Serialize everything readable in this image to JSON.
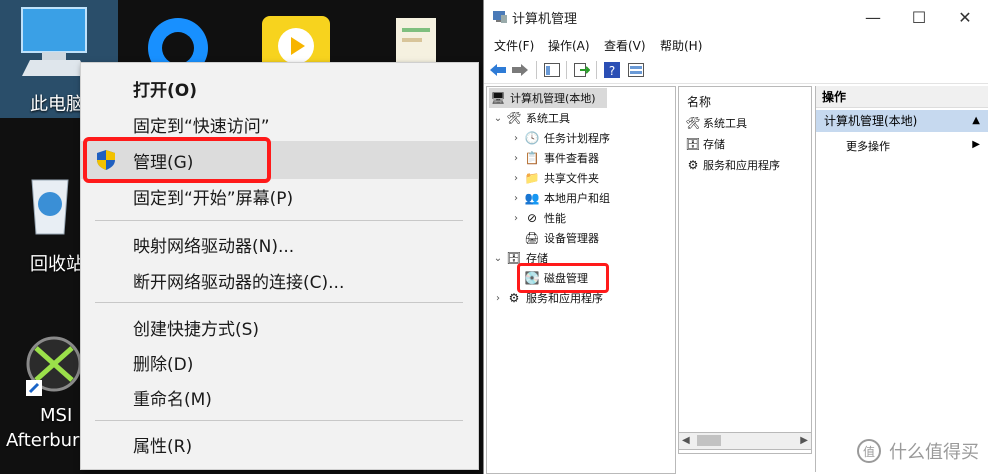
{
  "desktop": {
    "icons": [
      {
        "label": "此电脑",
        "icon": "this-pc-icon"
      },
      {
        "label": "回收站",
        "icon": "recycle-bin-icon"
      },
      {
        "label": "MSI",
        "label2": "Afterburner",
        "icon": "msi-afterburner-icon"
      }
    ],
    "context_menu": {
      "items": [
        {
          "label": "打开(O)"
        },
        {
          "label": "固定到“快速访问”"
        },
        {
          "label": "管理(G)"
        },
        {
          "label": "固定到“开始”屏幕(P)"
        },
        {
          "label": "映射网络驱动器(N)..."
        },
        {
          "label": "断开网络驱动器的连接(C)..."
        },
        {
          "label": "创建快捷方式(S)"
        },
        {
          "label": "删除(D)"
        },
        {
          "label": "重命名(M)"
        },
        {
          "label": "属性(R)"
        }
      ]
    }
  },
  "window": {
    "title": "计算机管理",
    "controls": {
      "minimize": "—",
      "maximize": "☐",
      "close": "✕"
    },
    "menu": [
      "文件(F)",
      "操作(A)",
      "查看(V)",
      "帮助(H)"
    ],
    "tree": [
      {
        "label": "计算机管理(本地)"
      },
      {
        "label": "系统工具"
      },
      {
        "label": "任务计划程序"
      },
      {
        "label": "事件查看器"
      },
      {
        "label": "共享文件夹"
      },
      {
        "label": "本地用户和组"
      },
      {
        "label": "性能"
      },
      {
        "label": "设备管理器"
      },
      {
        "label": "存储"
      },
      {
        "label": "磁盘管理"
      },
      {
        "label": "服务和应用程序"
      }
    ],
    "list": {
      "header": "名称",
      "rows": [
        "系统工具",
        "存储",
        "服务和应用程序"
      ]
    },
    "actions": {
      "header": "操作",
      "selected": "计算机管理(本地)",
      "more": "更多操作"
    }
  },
  "watermark": "什么值得买",
  "colors": {
    "highlight_red": "#ff1a1a",
    "actions_selected_bg": "#c6d9ef"
  }
}
